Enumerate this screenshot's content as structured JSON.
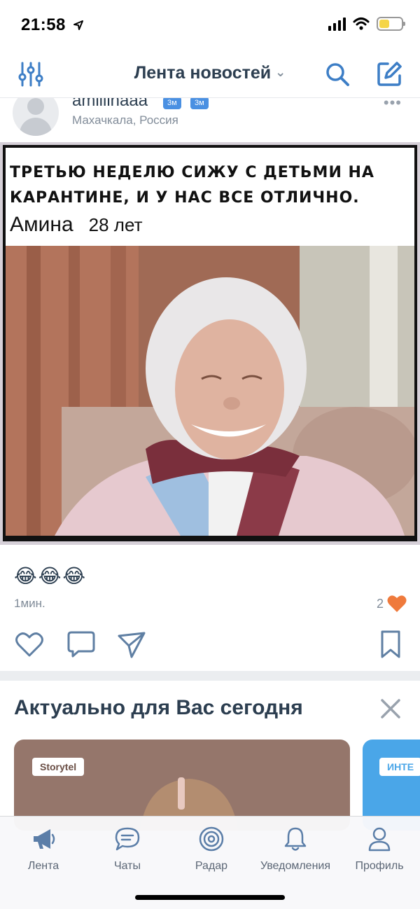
{
  "status_bar": {
    "time": "21:58"
  },
  "navbar": {
    "title": "Лента новостей"
  },
  "post": {
    "author": "amiiiinaaa",
    "badges": [
      "3м",
      "3м"
    ],
    "location": "Махачкала, Россия",
    "image_caption_line1": "Третью неделю сижу с детьми на",
    "image_caption_line2": "карантине, и у нас все отлично.",
    "image_caption_name": "Амина",
    "image_caption_age": "28 лет",
    "text": "😂😂😂",
    "time": "1мин.",
    "likes_count": "2"
  },
  "recommendations": {
    "title": "Актуально для Вас сегодня",
    "cards": [
      {
        "tag": "Storytel"
      },
      {
        "tag": "ИНТЕ"
      }
    ]
  },
  "tabbar": {
    "items": [
      {
        "label": "Лента",
        "icon": "megaphone-icon"
      },
      {
        "label": "Чаты",
        "icon": "chat-bubble-icon"
      },
      {
        "label": "Радар",
        "icon": "radar-icon"
      },
      {
        "label": "Уведомления",
        "icon": "bell-icon"
      },
      {
        "label": "Профиль",
        "icon": "person-icon"
      }
    ]
  },
  "colors": {
    "accent": "#4a90e2",
    "like": "#ef7a3c",
    "text_primary": "#2c3e50",
    "text_secondary": "#818c99"
  }
}
